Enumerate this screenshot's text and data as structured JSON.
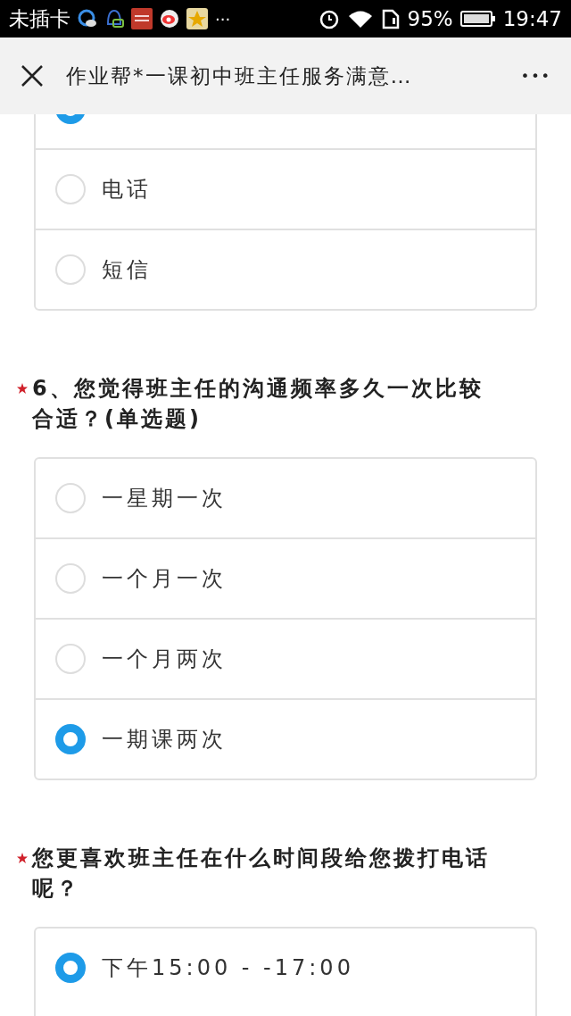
{
  "status_bar": {
    "carrier": "未插卡",
    "more": "···",
    "battery_text": "95%",
    "time": "19:47"
  },
  "header": {
    "title": "作业帮*一课初中班主任服务满意…",
    "menu": "•••"
  },
  "questions": [
    {
      "options": [
        {
          "selected": true
        },
        {
          "label": "电话",
          "selected": false
        },
        {
          "label": "短信",
          "selected": false
        }
      ]
    },
    {
      "required": true,
      "title": "6、您觉得班主任的沟通频率多久一次比较合适？(单选题)",
      "options": [
        {
          "label": "一星期一次",
          "selected": false
        },
        {
          "label": "一个月一次",
          "selected": false
        },
        {
          "label": "一个月两次",
          "selected": false
        },
        {
          "label": "一期课两次",
          "selected": true
        }
      ]
    },
    {
      "required": true,
      "title": "您更喜欢班主任在什么时间段给您拨打电话呢？",
      "options": [
        {
          "label": "下午15:00 - -17:00",
          "selected": true
        }
      ]
    }
  ]
}
